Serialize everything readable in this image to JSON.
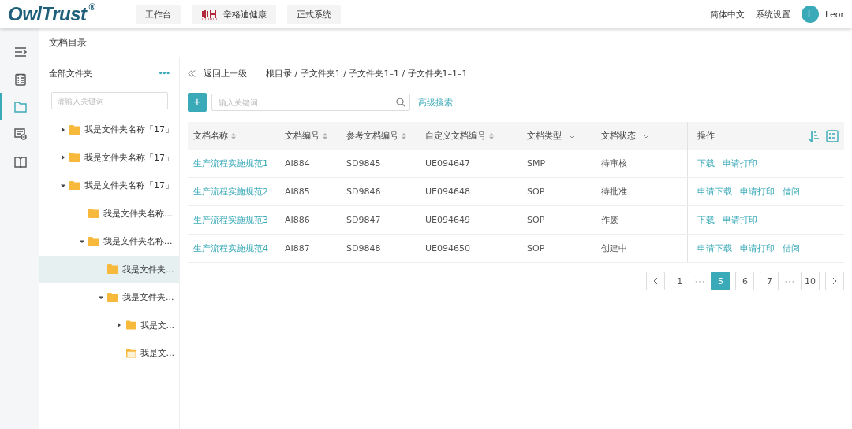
{
  "header": {
    "logo": "OwlTrust",
    "logo_mark": "®",
    "nav": [
      {
        "label": "工作台",
        "kind": "plain"
      },
      {
        "label": "辛格迪健康",
        "kind": "brand"
      },
      {
        "label": "正式系统",
        "kind": "plain"
      }
    ],
    "language": "简体中文",
    "settings": "系统设置",
    "avatar": "L",
    "user": "Leor"
  },
  "rail": [
    {
      "kind": "menu",
      "selected": false
    },
    {
      "kind": "list",
      "selected": false
    },
    {
      "kind": "folder",
      "selected": true
    },
    {
      "kind": "monitor",
      "selected": false
    },
    {
      "kind": "book",
      "selected": false
    }
  ],
  "page_title": "文档目录",
  "folders": {
    "title": "全部文件夹",
    "more": "•••",
    "search_placeholder": "请输入关键词",
    "tree": [
      {
        "label": "我是文件夹名称「17」",
        "kind": "folder",
        "expanded": false,
        "selected": false
      },
      {
        "label": "我是文件夹名称「17」",
        "kind": "folder",
        "expanded": false,
        "selected": false
      },
      {
        "label": "我是文件夹名称「17」",
        "kind": "folder",
        "expanded": true,
        "selected": false,
        "children": [
          {
            "label": "我是文件夹名称...",
            "kind": "folder",
            "selected": false
          },
          {
            "label": "我是文件夹名称...",
            "kind": "folder",
            "expanded": true,
            "selected": false,
            "children": [
              {
                "label": "我是文件夹...",
                "kind": "folder",
                "selected": true
              },
              {
                "label": "我是文件夹...",
                "kind": "folder",
                "expanded": true,
                "selected": false,
                "children": [
                  {
                    "label": "我是文...",
                    "kind": "folder",
                    "expanded": false,
                    "selected": false
                  },
                  {
                    "label": "我是文...",
                    "kind": "empty-folder",
                    "selected": false
                  }
                ]
              }
            ]
          }
        ]
      }
    ]
  },
  "breadcrumb": {
    "back": "返回上一级",
    "path": "根目录 / 子文件夹1 / 子文件夹1–1 / 子文件夹1–1–1"
  },
  "toolbar": {
    "add": "+",
    "search_placeholder": "输入关键词",
    "advanced": "高级搜索"
  },
  "table": {
    "columns": [
      {
        "label": "文档名称",
        "kind": "sort"
      },
      {
        "label": "文档编号",
        "kind": "sort"
      },
      {
        "label": "参考文档编号",
        "kind": "sort"
      },
      {
        "label": "自定义文档编号",
        "kind": "sort"
      },
      {
        "label": "文档类型",
        "kind": "filter"
      },
      {
        "label": "文档状态",
        "kind": "filter"
      },
      {
        "label": "操作",
        "kind": "actions"
      }
    ],
    "rows": [
      {
        "cells": [
          "生产流程实施规范1",
          "AI884",
          "SD9845",
          "UE094647",
          "SMP",
          "待审核"
        ],
        "actions": [
          "下载",
          "申请打印"
        ]
      },
      {
        "cells": [
          "生产流程实施规范2",
          "AI885",
          "SD9846",
          "UE094648",
          "SOP",
          "待批准"
        ],
        "actions": [
          "申请下载",
          "申请打印",
          "借阅"
        ]
      },
      {
        "cells": [
          "生产流程实施规范3",
          "AI886",
          "SD9847",
          "UE094649",
          "SOP",
          "作废"
        ],
        "actions": [
          "下载",
          "申请打印"
        ]
      },
      {
        "cells": [
          "生产流程实施规范4",
          "AI887",
          "SD9848",
          "UE094650",
          "SOP",
          "创建中"
        ],
        "actions": [
          "申请下载",
          "申请打印",
          "借阅"
        ]
      }
    ]
  },
  "pagination": {
    "items": [
      {
        "kind": "prev"
      },
      {
        "kind": "page",
        "label": "1",
        "selected": false
      },
      {
        "kind": "ellipsis",
        "label": "•••"
      },
      {
        "kind": "page",
        "label": "5",
        "selected": true
      },
      {
        "kind": "page",
        "label": "6",
        "selected": false
      },
      {
        "kind": "page",
        "label": "7",
        "selected": false
      },
      {
        "kind": "ellipsis",
        "label": "•••"
      },
      {
        "kind": "page",
        "label": "10",
        "selected": false
      },
      {
        "kind": "next"
      }
    ]
  }
}
